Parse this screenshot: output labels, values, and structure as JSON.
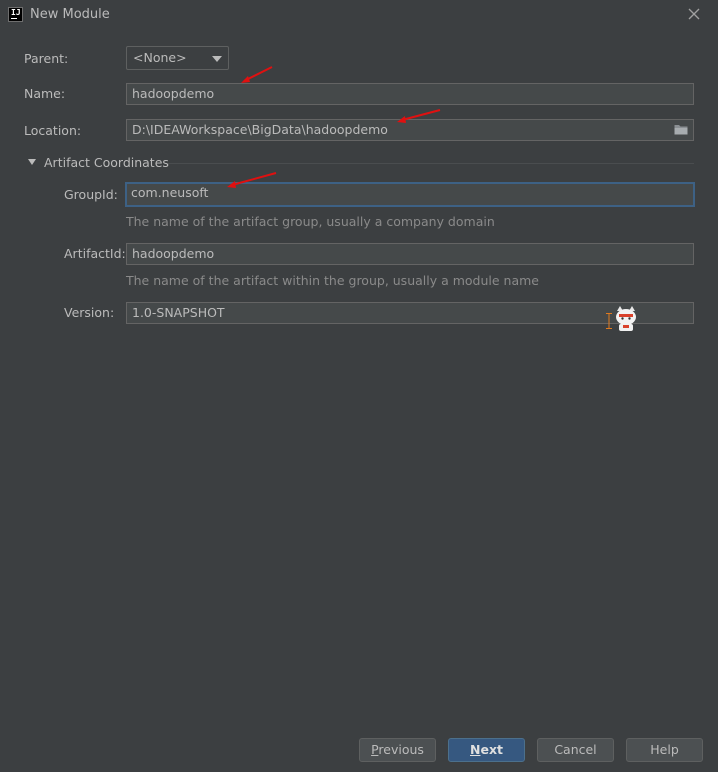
{
  "window": {
    "title": "New Module",
    "icon": "intellij-icon",
    "icon_text": "IJ"
  },
  "form": {
    "parent": {
      "label": "Parent:",
      "value": "<None>"
    },
    "name": {
      "label": "Name:",
      "value": "hadoopdemo"
    },
    "location": {
      "label": "Location:",
      "value": "D:\\IDEAWorkspace\\BigData\\hadoopdemo"
    }
  },
  "artifact": {
    "section_title": "Artifact Coordinates",
    "group_id": {
      "label": "GroupId:",
      "value": "com.neusoft",
      "hint": "The name of the artifact group, usually a company domain"
    },
    "artifact_id": {
      "label": "ArtifactId:",
      "value": "hadoopdemo",
      "hint": "The name of the artifact within the group, usually a module name"
    },
    "version": {
      "label": "Version:",
      "value": "1.0-SNAPSHOT"
    }
  },
  "buttons": {
    "previous": {
      "mnemonic": "P",
      "rest": "revious"
    },
    "next": {
      "mnemonic": "N",
      "rest": "ext"
    },
    "cancel": "Cancel",
    "help": "Help"
  },
  "colors": {
    "background": "#3c3f41",
    "field_bg": "#45494a",
    "focus_border": "#3d6185",
    "primary_button": "#365880",
    "annotation_arrow": "#e01010"
  }
}
